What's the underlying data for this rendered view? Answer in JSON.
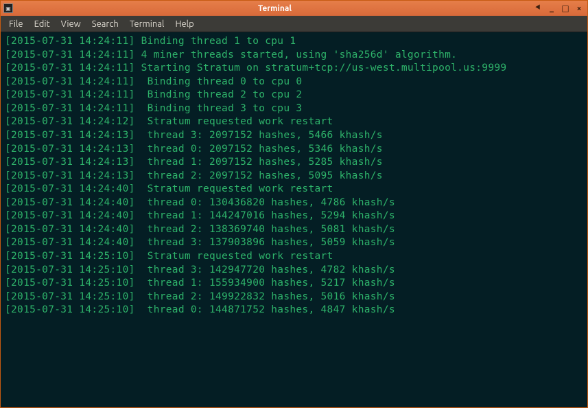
{
  "window": {
    "title": "Terminal"
  },
  "menubar": {
    "items": [
      "File",
      "Edit",
      "View",
      "Search",
      "Terminal",
      "Help"
    ]
  },
  "iconGlyph": "▣",
  "controls": {
    "stick": "⯇",
    "min": "_",
    "max": "□",
    "close": "×"
  },
  "lines": [
    {
      "ts": "[2015-07-31 14:24:11]",
      "msg": "Binding thread 1 to cpu 1"
    },
    {
      "ts": "[2015-07-31 14:24:11]",
      "msg": "4 miner threads started, using 'sha256d' algorithm."
    },
    {
      "ts": "[2015-07-31 14:24:11]",
      "msg": "Starting Stratum on stratum+tcp://us-west.multipool.us:9999"
    },
    {
      "ts": "[2015-07-31 14:24:11]",
      "msg": " Binding thread 0 to cpu 0"
    },
    {
      "ts": "[2015-07-31 14:24:11]",
      "msg": " Binding thread 2 to cpu 2"
    },
    {
      "ts": "[2015-07-31 14:24:11]",
      "msg": " Binding thread 3 to cpu 3"
    },
    {
      "ts": "[2015-07-31 14:24:12]",
      "msg": " Stratum requested work restart"
    },
    {
      "ts": "[2015-07-31 14:24:13]",
      "msg": " thread 3: 2097152 hashes, 5466 khash/s"
    },
    {
      "ts": "[2015-07-31 14:24:13]",
      "msg": " thread 0: 2097152 hashes, 5346 khash/s"
    },
    {
      "ts": "[2015-07-31 14:24:13]",
      "msg": " thread 1: 2097152 hashes, 5285 khash/s"
    },
    {
      "ts": "[2015-07-31 14:24:13]",
      "msg": " thread 2: 2097152 hashes, 5095 khash/s"
    },
    {
      "ts": "[2015-07-31 14:24:40]",
      "msg": " Stratum requested work restart"
    },
    {
      "ts": "[2015-07-31 14:24:40]",
      "msg": " thread 0: 130436820 hashes, 4786 khash/s"
    },
    {
      "ts": "[2015-07-31 14:24:40]",
      "msg": " thread 1: 144247016 hashes, 5294 khash/s"
    },
    {
      "ts": "[2015-07-31 14:24:40]",
      "msg": " thread 2: 138369740 hashes, 5081 khash/s"
    },
    {
      "ts": "[2015-07-31 14:24:40]",
      "msg": " thread 3: 137903896 hashes, 5059 khash/s"
    },
    {
      "ts": "[2015-07-31 14:25:10]",
      "msg": " Stratum requested work restart"
    },
    {
      "ts": "[2015-07-31 14:25:10]",
      "msg": " thread 3: 142947720 hashes, 4782 khash/s"
    },
    {
      "ts": "[2015-07-31 14:25:10]",
      "msg": " thread 1: 155934900 hashes, 5217 khash/s"
    },
    {
      "ts": "[2015-07-31 14:25:10]",
      "msg": " thread 2: 149922832 hashes, 5016 khash/s"
    },
    {
      "ts": "[2015-07-31 14:25:10]",
      "msg": " thread 0: 144871752 hashes, 4847 khash/s"
    }
  ]
}
